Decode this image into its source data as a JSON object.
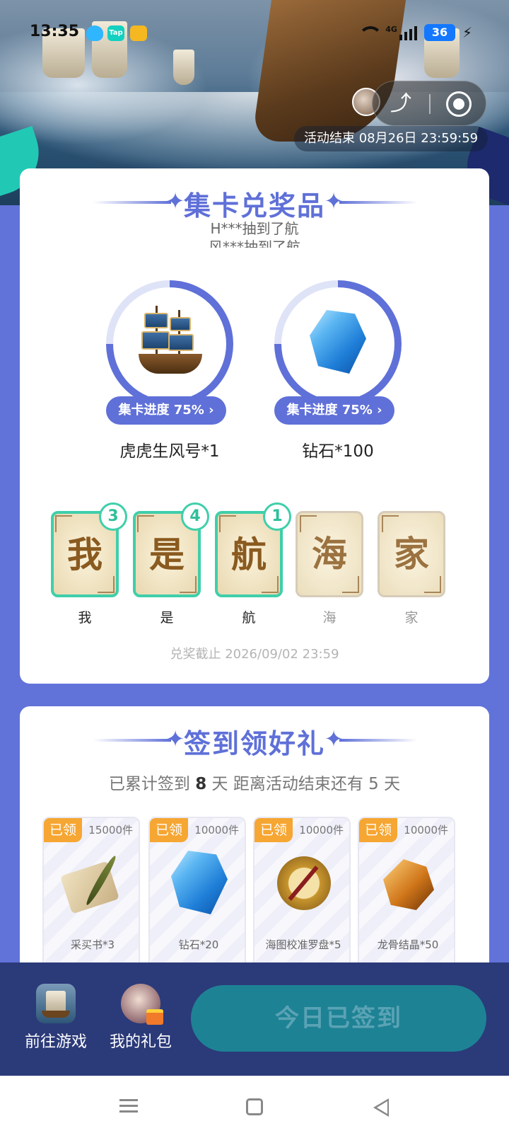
{
  "status_bar": {
    "time": "13:35",
    "network": "4G",
    "battery": "36"
  },
  "hero": {
    "event_end": "活动结束 08月26日 23:59:59"
  },
  "collect_section": {
    "title": "集卡兑奖品",
    "ticker_lines": [
      "H***抽到了航",
      "风***抽到了航"
    ],
    "prizes": [
      {
        "name": "虎虎生风号*1",
        "progress_label": "集卡进度 75% ",
        "progress": 0.75,
        "icon": "ship-icon"
      },
      {
        "name": "钻石*100",
        "progress_label": "集卡进度 75% ",
        "progress": 0.75,
        "icon": "diamond-icon"
      }
    ],
    "cards": [
      {
        "char": "我",
        "label": "我",
        "count": "3",
        "owned": true
      },
      {
        "char": "是",
        "label": "是",
        "count": "4",
        "owned": true
      },
      {
        "char": "航",
        "label": "航",
        "count": "1",
        "owned": true
      },
      {
        "char": "海",
        "label": "海",
        "count": "",
        "owned": false
      },
      {
        "char": "家",
        "label": "家",
        "count": "",
        "owned": false
      }
    ],
    "deadline": "兑奖截止 2026/09/02 23:59"
  },
  "signin_section": {
    "title": "签到领好礼",
    "summary_prefix": "已累计签到 ",
    "days_signed": "8",
    "summary_mid": " 天  距离活动结束还有 ",
    "days_left": "5",
    "summary_suffix": " 天",
    "rewards": [
      {
        "badge": "已领",
        "qty": "15000件",
        "name": "采买书*3",
        "icon": "scroll-quill-icon"
      },
      {
        "badge": "已领",
        "qty": "10000件",
        "name": "钻石*20",
        "icon": "diamond-icon"
      },
      {
        "badge": "已领",
        "qty": "10000件",
        "name": "海图校准罗盘*5",
        "icon": "compass-icon"
      },
      {
        "badge": "已领",
        "qty": "10000件",
        "name": "龙骨结晶*50",
        "icon": "amber-crystal-icon"
      }
    ]
  },
  "bottom_bar": {
    "go_game": "前往游戏",
    "my_gifts": "我的礼包",
    "signed_button": "今日已签到"
  },
  "colors": {
    "primary": "#5f70d8",
    "accent_teal": "#3fcfaa",
    "badge_orange": "#f6a632",
    "bottom_bar": "#2b3a79",
    "signed_button": "#1e8295"
  }
}
